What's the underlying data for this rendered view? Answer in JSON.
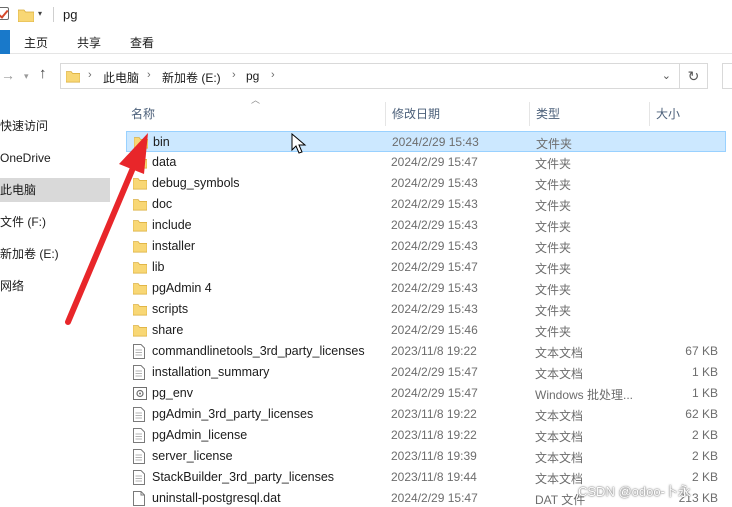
{
  "window": {
    "title": "pg"
  },
  "ribbon": {
    "tabs": [
      "主页",
      "共享",
      "查看"
    ]
  },
  "address": {
    "crumbs": [
      "此电脑",
      "新加卷 (E:)",
      "pg"
    ]
  },
  "sidebar": {
    "items": [
      {
        "label": "快速访问",
        "selected": false
      },
      {
        "label": "OneDrive",
        "selected": false
      },
      {
        "label": "此电脑",
        "selected": true
      },
      {
        "label": "文件 (F:)",
        "selected": false
      },
      {
        "label": "新加卷 (E:)",
        "selected": false
      },
      {
        "label": "网络",
        "selected": false
      }
    ]
  },
  "columns": {
    "name": "名称",
    "date": "修改日期",
    "type": "类型",
    "size": "大小"
  },
  "files": [
    {
      "name": "bin",
      "date": "2024/2/29 15:43",
      "type": "文件夹",
      "size": "",
      "icon": "folder-icon",
      "selected": true
    },
    {
      "name": "data",
      "date": "2024/2/29 15:47",
      "type": "文件夹",
      "size": "",
      "icon": "folder-icon"
    },
    {
      "name": "debug_symbols",
      "date": "2024/2/29 15:43",
      "type": "文件夹",
      "size": "",
      "icon": "folder-icon"
    },
    {
      "name": "doc",
      "date": "2024/2/29 15:43",
      "type": "文件夹",
      "size": "",
      "icon": "folder-icon"
    },
    {
      "name": "include",
      "date": "2024/2/29 15:43",
      "type": "文件夹",
      "size": "",
      "icon": "folder-icon"
    },
    {
      "name": "installer",
      "date": "2024/2/29 15:43",
      "type": "文件夹",
      "size": "",
      "icon": "folder-icon"
    },
    {
      "name": "lib",
      "date": "2024/2/29 15:47",
      "type": "文件夹",
      "size": "",
      "icon": "folder-icon"
    },
    {
      "name": "pgAdmin 4",
      "date": "2024/2/29 15:43",
      "type": "文件夹",
      "size": "",
      "icon": "folder-icon"
    },
    {
      "name": "scripts",
      "date": "2024/2/29 15:43",
      "type": "文件夹",
      "size": "",
      "icon": "folder-icon"
    },
    {
      "name": "share",
      "date": "2024/2/29 15:46",
      "type": "文件夹",
      "size": "",
      "icon": "folder-icon"
    },
    {
      "name": "commandlinetools_3rd_party_licenses",
      "date": "2023/11/8 19:22",
      "type": "文本文档",
      "size": "67 KB",
      "icon": "text-file-icon"
    },
    {
      "name": "installation_summary",
      "date": "2024/2/29 15:47",
      "type": "文本文档",
      "size": "1 KB",
      "icon": "text-file-icon"
    },
    {
      "name": "pg_env",
      "date": "2024/2/29 15:47",
      "type": "Windows 批处理...",
      "size": "1 KB",
      "icon": "batch-file-icon"
    },
    {
      "name": "pgAdmin_3rd_party_licenses",
      "date": "2023/11/8 19:22",
      "type": "文本文档",
      "size": "62 KB",
      "icon": "text-file-icon"
    },
    {
      "name": "pgAdmin_license",
      "date": "2023/11/8 19:22",
      "type": "文本文档",
      "size": "2 KB",
      "icon": "text-file-icon"
    },
    {
      "name": "server_license",
      "date": "2023/11/8 19:39",
      "type": "文本文档",
      "size": "2 KB",
      "icon": "text-file-icon"
    },
    {
      "name": "StackBuilder_3rd_party_licenses",
      "date": "2023/11/8 19:44",
      "type": "文本文档",
      "size": "2 KB",
      "icon": "text-file-icon"
    },
    {
      "name": "uninstall-postgresql.dat",
      "date": "2024/2/29 15:47",
      "type": "DAT 文件",
      "size": "213 KB",
      "icon": "dat-file-icon"
    }
  ],
  "watermark": {
    "text": "CSDN @odoo-卜永"
  },
  "colors": {
    "accent": "#1979ca",
    "selection": "#cce8ff",
    "folder": "#f8d775",
    "annotation_arrow": "#e8262a"
  }
}
